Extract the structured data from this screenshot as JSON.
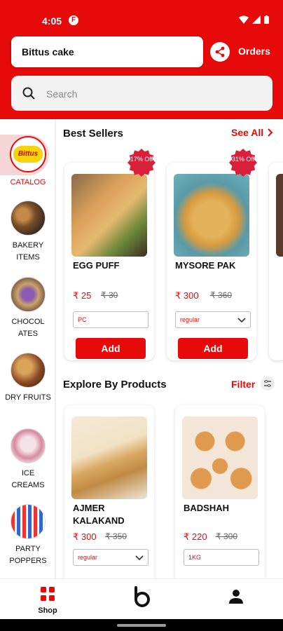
{
  "status_bar": {
    "time": "4:05",
    "app_icon_letter": "F"
  },
  "header": {
    "store_name": "Bittus cake",
    "orders_label": "Orders",
    "search_placeholder": "Search",
    "accent": "#e60a0a"
  },
  "sidebar": {
    "items": [
      {
        "label": "CATALOG",
        "logo_text": "Bittus",
        "active": true
      },
      {
        "label": "BAKERY ITEMS",
        "icon": "bakery-thumb"
      },
      {
        "label": "CHOCOL ATES",
        "icon": "chocolate-thumb"
      },
      {
        "label": "DRY FRUITS",
        "icon": "dry-fruits-thumb"
      },
      {
        "label": "ICE CREAMS",
        "icon": "ice-cream-thumb"
      },
      {
        "label": "PARTY POPPERS",
        "icon": "party-poppers-thumb"
      }
    ]
  },
  "best_sellers": {
    "title": "Best Sellers",
    "see_all": "See All",
    "items": [
      {
        "name": "EGG PUFF",
        "price": "₹ 25",
        "mrp": "₹ 30",
        "discount": "17% Off",
        "variant": "PC",
        "add_label": "Add"
      },
      {
        "name": "MYSORE PAK",
        "price": "₹ 300",
        "mrp": "₹ 360",
        "discount": "31% Off",
        "variant": "regular",
        "add_label": "Add"
      }
    ]
  },
  "explore": {
    "title": "Explore By Products",
    "filter_label": "Filter",
    "items": [
      {
        "name": "AJMER KALAKAND",
        "price": "₹ 300",
        "mrp": "₹ 350",
        "variant": "regular"
      },
      {
        "name": "BADSHAH",
        "price": "₹ 220",
        "mrp": "₹ 300",
        "variant": "1KG"
      }
    ]
  },
  "bottom_nav": {
    "shop_label": "Shop"
  }
}
